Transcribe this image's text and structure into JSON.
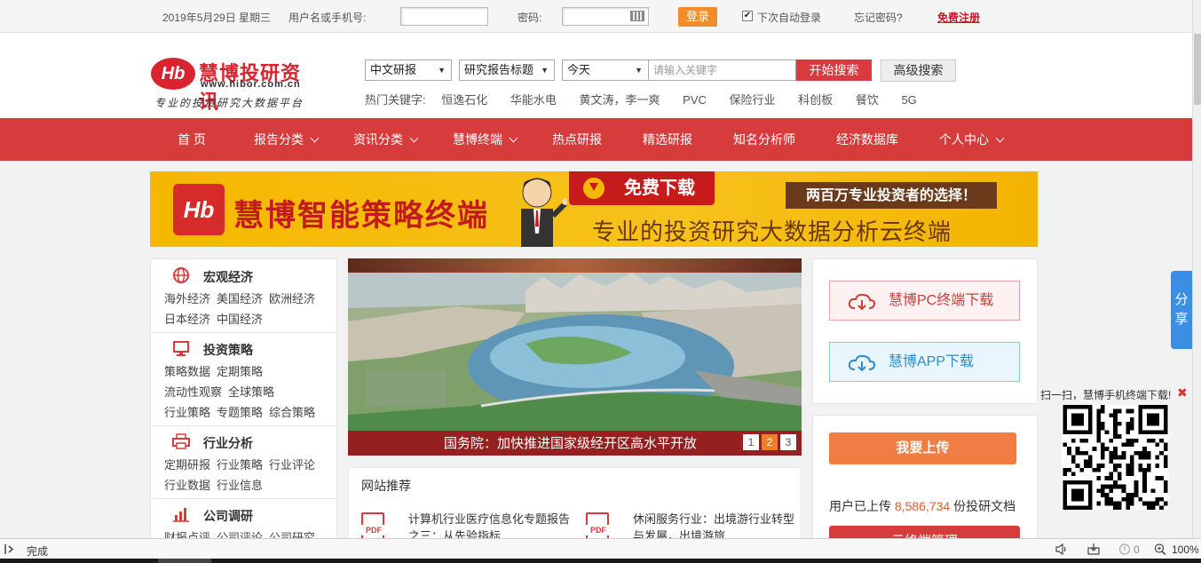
{
  "topbar": {
    "date": "2019年5月29日 星期三",
    "username_label": "用户名或手机号:",
    "password_label": "密码:",
    "login_button": "登录",
    "auto_login": "下次自动登录",
    "auto_login_checked": true,
    "forgot": "忘记密码?",
    "register": "免费注册"
  },
  "logo": {
    "mark": "Hb",
    "title": "慧博投研资讯",
    "url": "www.hibor.com.cn",
    "tagline": "专业的投资研究大数据平台"
  },
  "search": {
    "type_select": "中文研报",
    "field_select": "研究报告标题",
    "date_select": "今天",
    "placeholder": "请输入关键字",
    "search_button": "开始搜索",
    "advanced_button": "高级搜索",
    "hot_label": "热门关键字:",
    "hot_keywords": [
      "恒逸石化",
      "华能水电",
      "黄文涛，李一爽",
      "PVC",
      "保险行业",
      "科创板",
      "餐饮",
      "5G"
    ]
  },
  "nav": {
    "items": [
      {
        "label": "首 页"
      },
      {
        "label": "报告分类"
      },
      {
        "label": "资讯分类"
      },
      {
        "label": "慧博终端"
      },
      {
        "label": "热点研报"
      },
      {
        "label": "精选研报"
      },
      {
        "label": "知名分析师"
      },
      {
        "label": "经济数据库"
      },
      {
        "label": "个人中心"
      }
    ]
  },
  "banner": {
    "logo_mark": "Hb",
    "title": "慧博智能策略终端",
    "download": "免费下载",
    "slogan": "两百万专业投资者的选择！",
    "subtitle": "专业的投资研究大数据分析云终端"
  },
  "categories": [
    {
      "title": "宏观经济",
      "icon": "globe-icon",
      "links": [
        "海外经济",
        "美国经济",
        "欧洲经济",
        "日本经济",
        "中国经济"
      ]
    },
    {
      "title": "投资策略",
      "icon": "monitor-icon",
      "links": [
        "策略数据",
        "定期策略",
        "流动性观察",
        "全球策略",
        "行业策略",
        "专题策略",
        "综合策略"
      ]
    },
    {
      "title": "行业分析",
      "icon": "printer-icon",
      "links": [
        "定期研报",
        "行业策略",
        "行业评论",
        "行业数据",
        "行业信息"
      ]
    },
    {
      "title": "公司调研",
      "icon": "bar-chart-icon",
      "links": [
        "财报点评",
        "公司评论",
        "公司研究"
      ]
    }
  ],
  "slideshow": {
    "caption": "国务院：加快推进国家级经开区高水平开放",
    "pages": [
      "1",
      "2",
      "3"
    ],
    "active_page": 2
  },
  "recommend": {
    "title": "网站推荐",
    "items": [
      {
        "icon": "pdf-icon",
        "icon_label": "PDF",
        "text": "计算机行业医疗信息化专题报告之三：从先验指标"
      },
      {
        "icon": "pdf-icon",
        "icon_label": "PDF",
        "text": "休闲服务行业：出境游行业转型与发展，出境游旅"
      }
    ]
  },
  "downloads": {
    "pc": "慧博PC终端下载",
    "app": "慧博APP下载"
  },
  "upload": {
    "button": "我要上传",
    "stat_prefix": "用户已上传",
    "count": "8,586,734",
    "stat_suffix": "份投研文档",
    "terminal_button": "云终端管理"
  },
  "share": {
    "label": "分享"
  },
  "qr": {
    "text": "扫一扫，慧博手机终端下载!"
  },
  "statusbar": {
    "status": "完成",
    "count": "0",
    "zoom": "100%"
  },
  "colors": {
    "brand_red": "#d73c3c",
    "accent_orange": "#f07d43",
    "banner_yellow": "#f5b800",
    "link_blue": "#2f8ccc"
  }
}
